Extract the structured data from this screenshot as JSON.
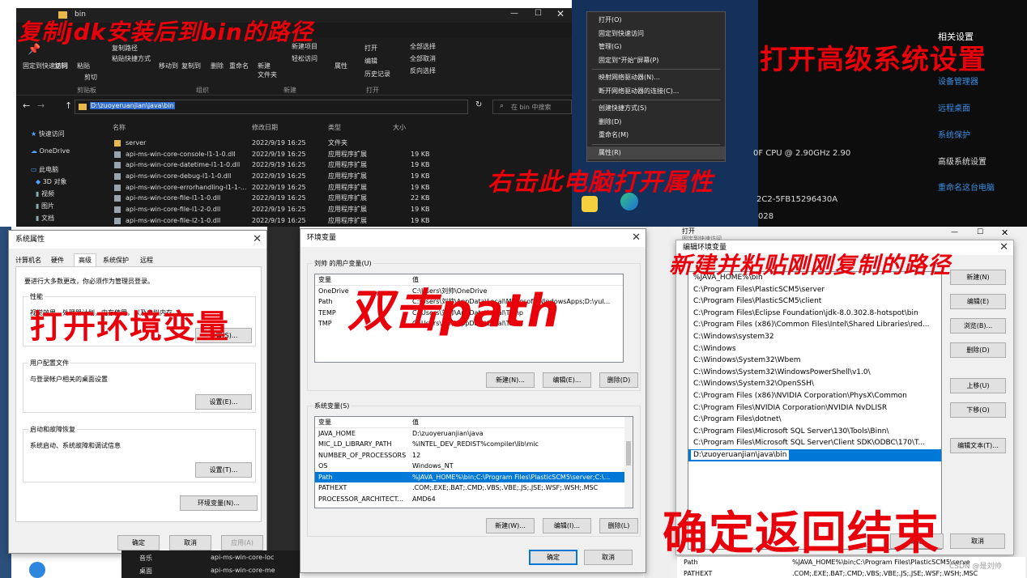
{
  "explorer": {
    "title": "bin",
    "ribbon": {
      "pin_quick_access": "固定到快速访问",
      "copy": "复制",
      "paste": "粘贴",
      "copy_path": "复制路径",
      "paste_shortcut": "粘贴快捷方式",
      "cut": "剪切",
      "move_to": "移动到",
      "copy_to": "复制到",
      "delete": "删除",
      "rename": "重命名",
      "new_folder": "新建\n文件夹",
      "new_item": "新建项目",
      "easy_access": "轻松访问",
      "properties": "属性",
      "open": "打开",
      "edit": "编辑",
      "history": "历史记录",
      "select_all": "全部选择",
      "select_none": "全部取消",
      "invert_selection": "反向选择",
      "group_clipboard": "剪贴板",
      "group_organize": "组织",
      "group_new": "新建",
      "group_open": "打开"
    },
    "address": "D:\\zuoyeruanjian\\java\\bin",
    "search_placeholder": "在 bin 中搜索",
    "columns": [
      "名称",
      "修改日期",
      "类型",
      "大小"
    ],
    "nav": [
      "快速访问",
      "OneDrive",
      "此电脑",
      "3D 对象",
      "视频",
      "图片",
      "文档"
    ],
    "files": [
      {
        "name": "server",
        "date": "2022/9/19 16:25",
        "type": "文件夹",
        "size": ""
      },
      {
        "name": "api-ms-win-core-console-l1-1-0.dll",
        "date": "2022/9/19 16:25",
        "type": "应用程序扩展",
        "size": "19 KB"
      },
      {
        "name": "api-ms-win-core-datetime-l1-1-0.dll",
        "date": "2022/9/19 16:25",
        "type": "应用程序扩展",
        "size": "19 KB"
      },
      {
        "name": "api-ms-win-core-debug-l1-1-0.dll",
        "date": "2022/9/19 16:25",
        "type": "应用程序扩展",
        "size": "19 KB"
      },
      {
        "name": "api-ms-win-core-errorhandling-l1-1-...",
        "date": "2022/9/19 16:25",
        "type": "应用程序扩展",
        "size": "19 KB"
      },
      {
        "name": "api-ms-win-core-file-l1-1-0.dll",
        "date": "2022/9/19 16:25",
        "type": "应用程序扩展",
        "size": "22 KB"
      },
      {
        "name": "api-ms-win-core-file-l1-2-0.dll",
        "date": "2022/9/19 16:25",
        "type": "应用程序扩展",
        "size": "19 KB"
      },
      {
        "name": "api-ms-win-core-file-l2-1-0.dll",
        "date": "2022/9/19 16:25",
        "type": "应用程序扩展",
        "size": "19 KB"
      }
    ]
  },
  "context_menu": {
    "items": [
      "打开(O)",
      "固定到快速访问",
      "管理(G)",
      "固定到\"开始\"屏幕(P)",
      "映射网络驱动器(N)...",
      "断开网络驱动器的连接(C)...",
      "创建快捷方式(S)",
      "删除(D)",
      "重命名(M)",
      "属性(R)"
    ]
  },
  "settings_panel": {
    "heading": "相关设置",
    "links": [
      "设备管理器",
      "远程桌面",
      "系统保护",
      "高级系统设置",
      "重命名这台电脑"
    ],
    "cpu": "0F CPU @ 2.90GHz   2.90",
    "id_fragment": "2C2-5FB15296430A",
    "code_fragment": "028"
  },
  "system_props": {
    "title": "系统属性",
    "tabs": [
      "计算机名",
      "硬件",
      "高级",
      "系统保护",
      "远程"
    ],
    "admin_note": "要进行大多数更改，你必须作为管理员登录。",
    "perf_label": "性能",
    "perf_desc": "视觉效果，处理器计划，内存使用，以及虚拟内存",
    "perf_btn": "设置(S)...",
    "profile_label": "用户配置文件",
    "profile_desc": "与登录帐户相关的桌面设置",
    "profile_btn": "设置(E)...",
    "startup_label": "启动和故障恢复",
    "startup_desc": "系统启动、系统故障和调试信息",
    "startup_btn": "设置(T)...",
    "env_btn": "环境变量(N)...",
    "ok": "确定",
    "cancel": "取消",
    "apply": "应用(A)"
  },
  "env_vars": {
    "title": "环境变量",
    "user_label": "刘帅 的用户变量(U)",
    "col_var": "变量",
    "col_val": "值",
    "user_vars": [
      {
        "name": "OneDrive",
        "value": "C:\\Users\\刘帅\\OneDrive"
      },
      {
        "name": "Path",
        "value": "C:\\Users\\刘帅\\AppData\\Local\\Microsoft\\WindowsApps;D:\\yul..."
      },
      {
        "name": "TEMP",
        "value": "C:\\Users\\刘帅\\AppData\\Local\\Temp"
      },
      {
        "name": "TMP",
        "value": "C:\\Users\\刘帅\\AppData\\Local\\Temp"
      }
    ],
    "sys_label": "系统变量(S)",
    "sys_vars": [
      {
        "name": "JAVA_HOME",
        "value": "D:\\zuoyeruanjian\\java"
      },
      {
        "name": "MIC_LD_LIBRARY_PATH",
        "value": "%INTEL_DEV_REDIST%compiler\\lib\\mic"
      },
      {
        "name": "NUMBER_OF_PROCESSORS",
        "value": "12"
      },
      {
        "name": "OS",
        "value": "Windows_NT"
      },
      {
        "name": "Path",
        "value": "%JAVA_HOME%\\bin;C:\\Program Files\\PlasticSCM5\\server;C:\\..."
      },
      {
        "name": "PATHEXT",
        "value": ".COM;.EXE;.BAT;.CMD;.VBS;.VBE;.JS;.JSE;.WSF;.WSH;.MSC"
      },
      {
        "name": "PROCESSOR_ARCHITECT...",
        "value": "AMD64"
      }
    ],
    "new_btn": "新建(N)...",
    "edit_btn": "编辑(E)...",
    "delete_btn": "删除(D)",
    "new_btn2": "新建(W)...",
    "edit_btn2": "编辑(I)...",
    "delete_btn2": "删除(L)",
    "ok": "确定",
    "cancel": "取消"
  },
  "edit_env": {
    "title": "编辑环境变量",
    "top_fragment": "打开",
    "top_fragment2": "固定到快速访问",
    "paths": [
      "%JAVA_HOME%\\bin",
      "C:\\Program Files\\PlasticSCM5\\server",
      "C:\\Program Files\\PlasticSCM5\\client",
      "C:\\Program Files\\Eclipse Foundation\\jdk-8.0.302.8-hotspot\\bin",
      "C:\\Program Files (x86)\\Common Files\\Intel\\Shared Libraries\\red...",
      "C:\\Windows\\system32",
      "C:\\Windows",
      "C:\\Windows\\System32\\Wbem",
      "C:\\Windows\\System32\\WindowsPowerShell\\v1.0\\",
      "C:\\Windows\\System32\\OpenSSH\\",
      "C:\\Program Files (x86)\\NVIDIA Corporation\\PhysX\\Common",
      "C:\\Program Files\\NVIDIA Corporation\\NVIDIA NvDLISR",
      "C:\\Program Files\\dotnet\\",
      "C:\\Program Files\\Microsoft SQL Server\\130\\Tools\\Binn\\",
      "C:\\Program Files\\Microsoft SQL Server\\Client SDK\\ODBC\\170\\T...",
      "D:\\zuoyeruanjian\\java\\bin"
    ],
    "buttons": [
      "新建(N)",
      "编辑(E)",
      "浏览(B)...",
      "删除(D)",
      "上移(U)",
      "下移(O)",
      "编辑文本(T)..."
    ],
    "ok": "确定",
    "cancel": "取消",
    "bottom_rows": [
      {
        "name": "Path",
        "value": "%JAVA_HOME%\\bin;C:\\Program Files\\PlasticSCM5\\serve"
      },
      {
        "name": "PATHEXT",
        "value": ".COM;.EXE;.BAT;.CMD;.VBS;.VBE;.JS;.JSE;.WSF;.WSH;.MSC"
      }
    ],
    "watermark": "CSDN @是刘帅"
  },
  "desktop_left": {
    "bottom_items": [
      "音乐",
      "桌面"
    ],
    "bottom_files": [
      "api-ms-win-core-loc",
      "api-ms-win-core-me"
    ]
  },
  "annotations": {
    "a1": "复制jdk安装后到bin的路径",
    "a2": "打开高级系统设置",
    "a3": "右击此电脑打开属性",
    "a4": "打开环境变量",
    "a5": "双击path",
    "a6": "新建并粘贴刚刚复制的路径",
    "a7": "确定返回结束"
  },
  "colors": {
    "accent": "#0078d7",
    "annotation": "#e8000b",
    "dark_bg": "#191919",
    "link": "#3b8fe6"
  }
}
